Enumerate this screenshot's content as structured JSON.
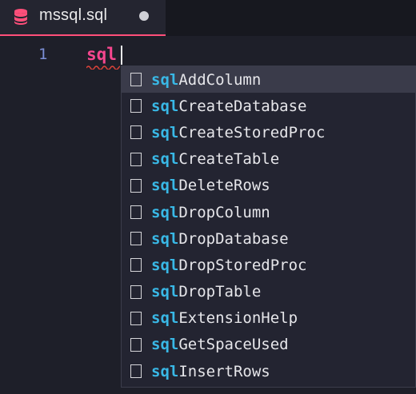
{
  "tab": {
    "title": "mssql.sql",
    "icon": "database-icon",
    "dirty_indicator": "unsaved-dot"
  },
  "editor": {
    "line_number": "1",
    "line_text": "sql"
  },
  "suggestions": {
    "query_prefix": "sql",
    "items": [
      {
        "prefix": "sql",
        "rest": "AddColumn",
        "icon": "snippet-icon"
      },
      {
        "prefix": "sql",
        "rest": "CreateDatabase",
        "icon": "snippet-icon"
      },
      {
        "prefix": "sql",
        "rest": "CreateStoredProc",
        "icon": "snippet-icon"
      },
      {
        "prefix": "sql",
        "rest": "CreateTable",
        "icon": "snippet-icon"
      },
      {
        "prefix": "sql",
        "rest": "DeleteRows",
        "icon": "snippet-icon"
      },
      {
        "prefix": "sql",
        "rest": "DropColumn",
        "icon": "snippet-icon"
      },
      {
        "prefix": "sql",
        "rest": "DropDatabase",
        "icon": "snippet-icon"
      },
      {
        "prefix": "sql",
        "rest": "DropStoredProc",
        "icon": "snippet-icon"
      },
      {
        "prefix": "sql",
        "rest": "DropTable",
        "icon": "snippet-icon"
      },
      {
        "prefix": "sql",
        "rest": "ExtensionHelp",
        "icon": "snippet-icon"
      },
      {
        "prefix": "sql",
        "rest": "GetSpaceUsed",
        "icon": "snippet-icon"
      },
      {
        "prefix": "sql",
        "rest": "InsertRows",
        "icon": "snippet-icon"
      }
    ]
  },
  "colors": {
    "tab_accent": "#ff4f7a",
    "code_keyword": "#f7478f",
    "match_highlight": "#39b8e6",
    "line_number": "#7c8fd6",
    "background": "#1e1f29"
  }
}
